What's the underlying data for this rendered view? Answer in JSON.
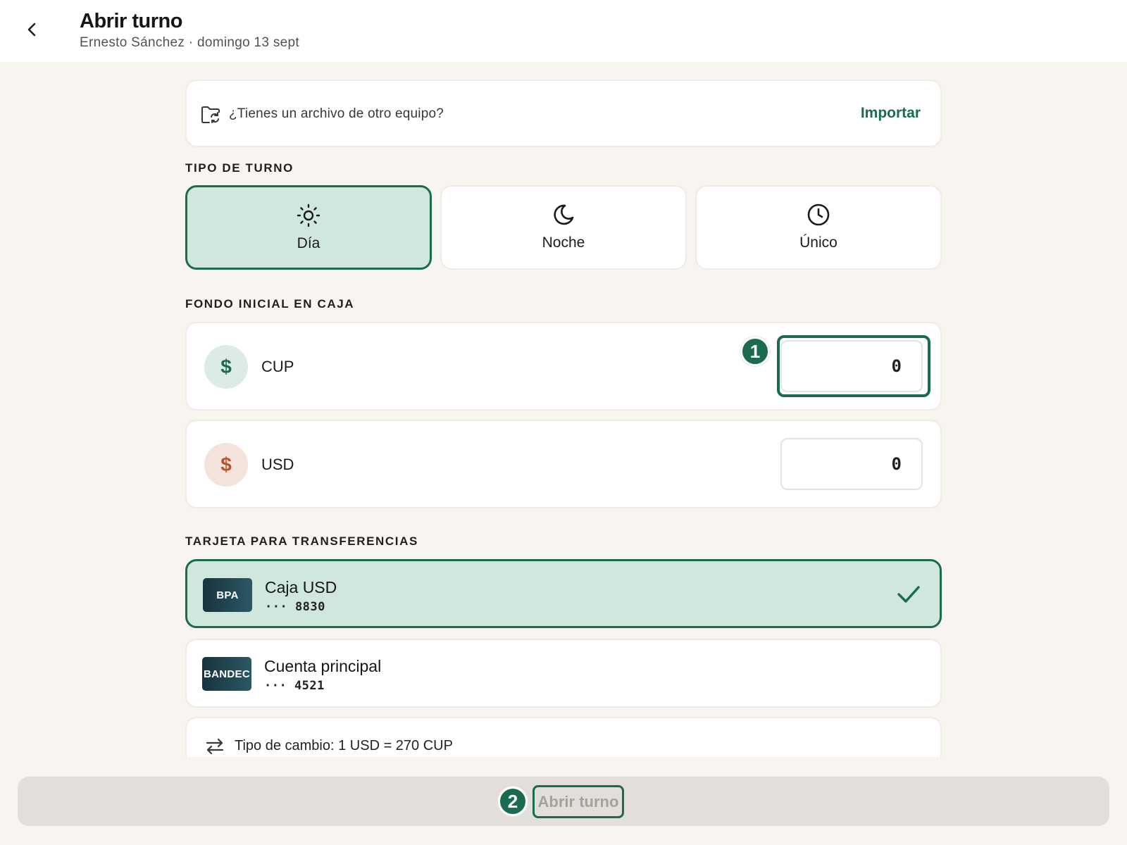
{
  "header": {
    "title": "Abrir turno",
    "subtitle": "Ernesto Sánchez · domingo 13 sept",
    "back_icon": "chevron-left-icon"
  },
  "import": {
    "question": "¿Tienes un archivo de otro equipo?",
    "action": "Importar",
    "icon": "folder-sync-icon"
  },
  "shift_type": {
    "label": "TIPO DE TURNO",
    "selected": "Día",
    "options": [
      {
        "label": "Día",
        "icon": "sun-icon"
      },
      {
        "label": "Noche",
        "icon": "moon-icon"
      },
      {
        "label": "Único",
        "icon": "clock-icon"
      }
    ]
  },
  "initial_fund": {
    "label": "FONDO INICIAL EN CAJA",
    "currencies": [
      {
        "code": "CUP",
        "symbol": "$",
        "value": "0",
        "color": "#1a6b4f",
        "bg": "#dcebe5"
      },
      {
        "code": "USD",
        "symbol": "$",
        "value": "0",
        "color": "#b8532a",
        "bg": "#f4e3da"
      }
    ]
  },
  "transfer_card": {
    "label": "TARJETA PARA TRANSFERENCIAS",
    "cards": [
      {
        "bank": "BPA",
        "name": "Caja USD",
        "masked": "··· 8830",
        "selected": true
      },
      {
        "bank": "BANDEC",
        "name": "Cuenta principal",
        "masked": "··· 4521",
        "selected": false
      }
    ]
  },
  "exchange": {
    "text": "Tipo de cambio: 1 USD = 270 CUP",
    "icon": "swap-arrows-icon"
  },
  "footer": {
    "submit_label": "Abrir turno"
  },
  "annotations": {
    "badge_1": "1",
    "badge_2": "2"
  },
  "colors": {
    "accent": "#1a6b4f",
    "selected_bg": "#cfe7dc",
    "page_bg": "#f8f5f0"
  }
}
